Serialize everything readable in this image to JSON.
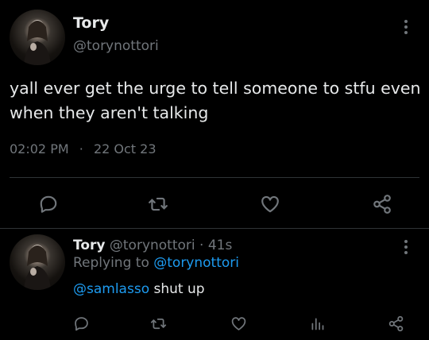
{
  "main_tweet": {
    "display_name": "Tory",
    "handle": "@torynottori",
    "text": "yall ever get the urge to tell someone to stfu even when they aren't talking",
    "time": "02:02 PM",
    "separator": "·",
    "date": "22 Oct 23"
  },
  "reply": {
    "display_name": "Tory",
    "handle": "@torynottori",
    "separator": "·",
    "age": "41s",
    "replying_to_label": "Replying to",
    "replying_to_handle": "@torynottori",
    "mention": "@samlasso",
    "text": "shut up"
  },
  "icons": {
    "reply": "reply-icon",
    "retweet": "retweet-icon",
    "like": "heart-icon",
    "share": "share-icon",
    "analytics": "analytics-icon",
    "more": "more-icon"
  },
  "colors": {
    "background": "#000000",
    "text": "#e7e9ea",
    "muted": "#71767b",
    "link": "#1d9bf0",
    "divider": "#2f3336"
  }
}
